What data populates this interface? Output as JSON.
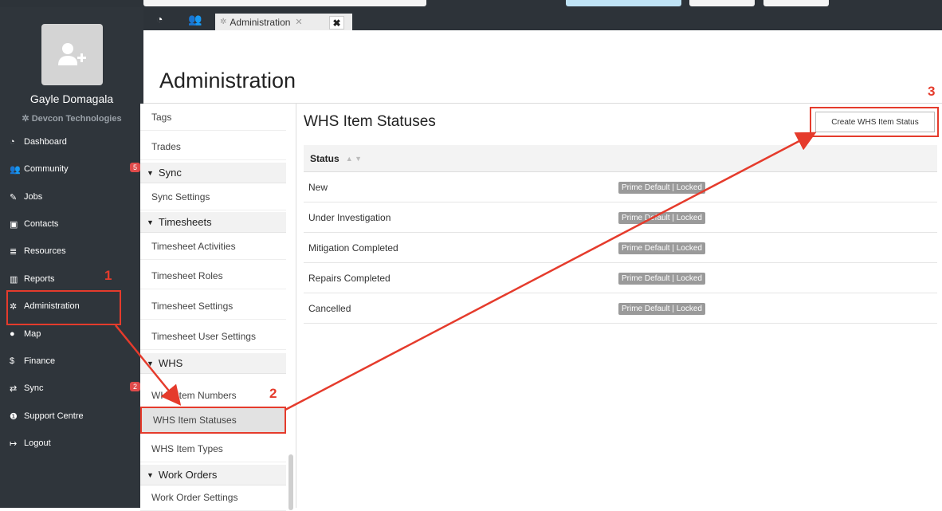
{
  "sidebar": {
    "user_name": "Gayle Domagala",
    "company": "Devcon Technologies",
    "items": [
      {
        "label": "Dashboard",
        "icon": "dashboard-icon",
        "glyph": "◔"
      },
      {
        "label": "Community",
        "icon": "users-icon",
        "glyph": "👥",
        "badge": "5"
      },
      {
        "label": "Jobs",
        "icon": "wrench-icon",
        "glyph": "✎"
      },
      {
        "label": "Contacts",
        "icon": "contacts-icon",
        "glyph": "▣"
      },
      {
        "label": "Resources",
        "icon": "database-icon",
        "glyph": "≣"
      },
      {
        "label": "Reports",
        "icon": "bar-chart-icon",
        "glyph": "▥"
      },
      {
        "label": "Administration",
        "icon": "gear-icon",
        "glyph": "✲"
      },
      {
        "label": "Map",
        "icon": "globe-icon",
        "glyph": "●"
      },
      {
        "label": "Finance",
        "icon": "dollar-icon",
        "glyph": "$"
      },
      {
        "label": "Sync",
        "icon": "sync-icon",
        "glyph": "⇄",
        "badge": "2"
      },
      {
        "label": "Support Centre",
        "icon": "info-icon",
        "glyph": "❶"
      },
      {
        "label": "Logout",
        "icon": "logout-icon",
        "glyph": "↦"
      }
    ]
  },
  "tabs": {
    "admin_tab_label": "Administration",
    "close_glyph": "✕",
    "close_all_glyph": "✖"
  },
  "header": {
    "title": "Administration"
  },
  "settings_list": [
    {
      "type": "item",
      "label": "Tags"
    },
    {
      "type": "item",
      "label": "Trades"
    },
    {
      "type": "section",
      "label": "Sync"
    },
    {
      "type": "item",
      "label": "Sync Settings"
    },
    {
      "type": "section",
      "label": "Timesheets"
    },
    {
      "type": "item",
      "label": "Timesheet Activities"
    },
    {
      "type": "item",
      "label": "Timesheet Roles"
    },
    {
      "type": "item",
      "label": "Timesheet Settings"
    },
    {
      "type": "item",
      "label": "Timesheet User Settings"
    },
    {
      "type": "section",
      "label": "WHS"
    },
    {
      "type": "item",
      "label": "WHS Item Numbers"
    },
    {
      "type": "item",
      "label": "WHS Item Statuses",
      "active": true
    },
    {
      "type": "item",
      "label": "WHS Item Types"
    },
    {
      "type": "section",
      "label": "Work Orders"
    },
    {
      "type": "item",
      "label": "Work Order Settings"
    }
  ],
  "main": {
    "title": "WHS Item Statuses",
    "create_button": "Create WHS Item Status",
    "column_header": "Status",
    "rows": [
      {
        "name": "New",
        "badge": "Prime Default | Locked"
      },
      {
        "name": "Under Investigation",
        "badge": "Prime Default | Locked"
      },
      {
        "name": "Mitigation Completed",
        "badge": "Prime Default | Locked"
      },
      {
        "name": "Repairs Completed",
        "badge": "Prime Default | Locked"
      },
      {
        "name": "Cancelled",
        "badge": "Prime Default | Locked"
      }
    ]
  },
  "annotations": {
    "step1": "1",
    "step2": "2",
    "step3": "3"
  },
  "colors": {
    "sidebar_bg": "#2f353b",
    "annotation_red": "#e53b2c",
    "badge_gray": "#9a9a9a",
    "notification_red": "#e04b4b"
  }
}
